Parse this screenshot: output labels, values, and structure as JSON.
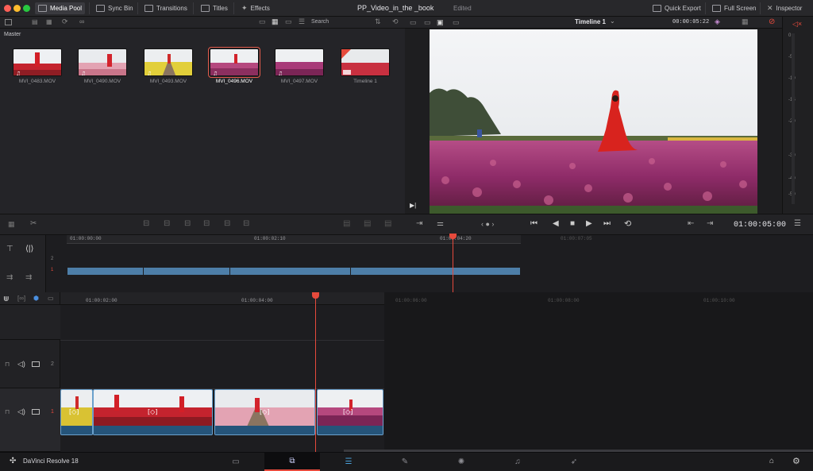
{
  "topbar": {
    "media_pool": "Media Pool",
    "sync_bin": "Sync Bin",
    "transitions": "Transitions",
    "titles": "Titles",
    "effects": "Effects",
    "project_title": "PP_Video_in_the _book",
    "project_status": "Edited",
    "quick_export": "Quick Export",
    "full_screen": "Full Screen",
    "inspector": "Inspector"
  },
  "media_pool": {
    "search_label": "Search",
    "bin_name": "Master",
    "clips": [
      {
        "name": "MVI_0483.MOV"
      },
      {
        "name": "MVI_0490.MOV"
      },
      {
        "name": "MVI_0493.MOV"
      },
      {
        "name": "MVI_0496.MOV",
        "selected": true
      },
      {
        "name": "MVI_0497.MOV"
      },
      {
        "name": "Timeline 1"
      }
    ]
  },
  "viewer": {
    "timeline_name": "Timeline 1",
    "duration_tc": "00:00:05:22",
    "current_tc": "01:00:05:00"
  },
  "audio_meter": {
    "labels": [
      "0",
      "-5",
      "-10",
      "-15",
      "-20",
      "-30",
      "-40",
      "-50"
    ]
  },
  "overview_ruler": {
    "labels": [
      "01:00:00:00",
      "01:00:02:10",
      "01:00:04:20",
      "01:00:07:05"
    ]
  },
  "timeline_ruler": {
    "labels": [
      "01:00:02:00",
      "01:00:04:00",
      "01:00:06:00",
      "01:00:08:00",
      "01:00:10:00"
    ]
  },
  "tracks": {
    "video_2": "2",
    "video_1": "1",
    "ovl_2": "2",
    "ovl_1": "1"
  },
  "bottombar": {
    "app_name": "DaVinci Resolve 18"
  },
  "colors": {
    "accent_red": "#e64a3c",
    "clip_blue": "#2c5f88",
    "overview_clip_blue": "#4d7ea8"
  }
}
